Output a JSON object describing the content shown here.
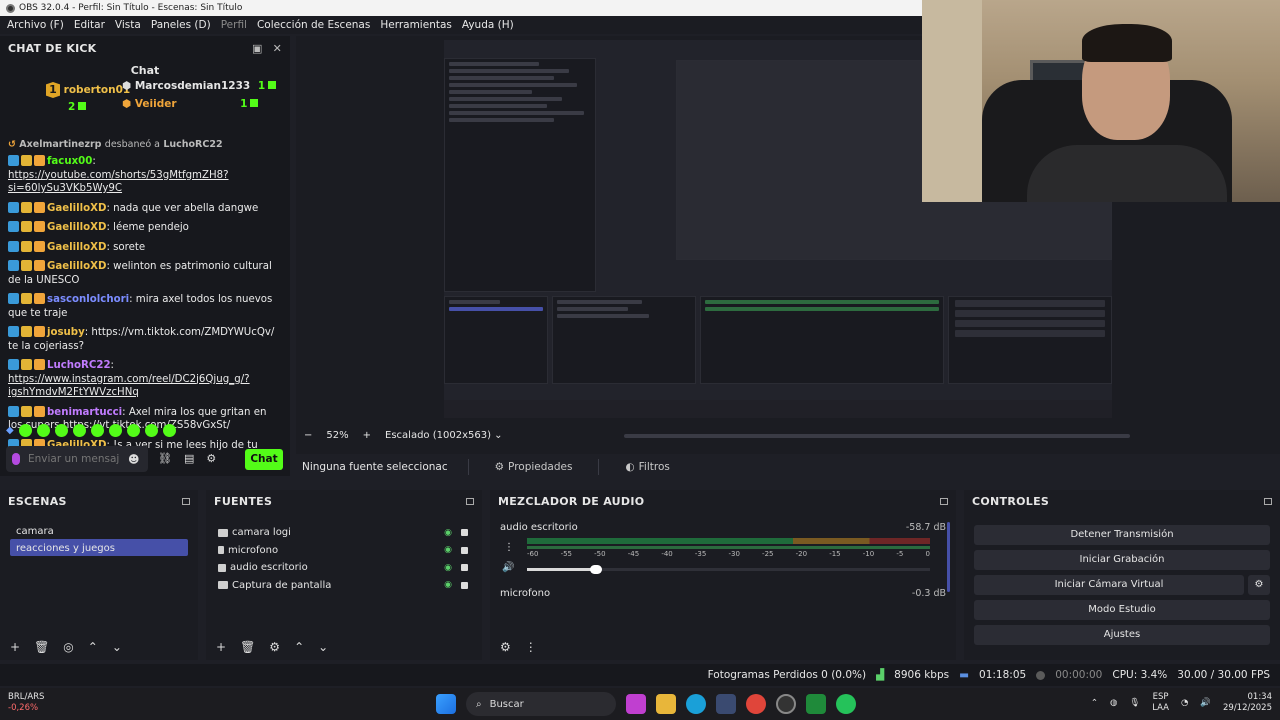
{
  "window": {
    "title": "OBS 32.0.4 - Perfil: Sin Título - Escenas: Sin Título"
  },
  "menu": [
    "Archivo (F)",
    "Editar",
    "Vista",
    "Paneles (D)",
    "Perfil",
    "Colección de Escenas",
    "Herramientas",
    "Ayuda (H)"
  ],
  "chat": {
    "dock_title": "CHAT DE KICK",
    "sub_title": "Chat",
    "leaders": [
      {
        "rank": "1",
        "name": "roberton01",
        "count": "2"
      },
      {
        "name": "Marcosdemian1233",
        "count": "1"
      },
      {
        "name": "Veiider",
        "count": "1"
      }
    ],
    "announcement": {
      "user": "Axelmartinezrp",
      "action": "desbaneó a",
      "target": "LuchoRC22"
    },
    "messages": [
      {
        "user": "facux00",
        "text": "https://youtube.com/shorts/53gMtfgmZH8?si=60lySu3VKb5Wy9C",
        "link": true,
        "color": "#53fc18"
      },
      {
        "user": "GaelilloXD",
        "text": "nada que ver abella dangwe",
        "color": "#f0c049"
      },
      {
        "user": "GaelilloXD",
        "text": "léeme pendejo",
        "color": "#f0c049"
      },
      {
        "user": "GaelilloXD",
        "text": "sorete",
        "color": "#f0c049"
      },
      {
        "user": "GaelilloXD",
        "text": "welinton es patrimonio cultural de la UNESCO",
        "color": "#f0c049"
      },
      {
        "user": "sasconlolchori",
        "text": "mira axel todos los nuevos que te traje",
        "color": "#7b8cff"
      },
      {
        "user": "josuby",
        "text": "https://vm.tiktok.com/ZMDYWUcQv/ te la cojeriass?",
        "color": "#f0c049"
      },
      {
        "user": "LuchoRC22",
        "text": "https://www.instagram.com/reel/DC2j6Qjug_g/?igshYmdvM2FtYWVzcHNq",
        "link": true,
        "color": "#c17cff"
      },
      {
        "user": "benimartucci",
        "text": "Axel mira los que gritan en los supers https://vt.tiktok.com/ZS58vGxSt/",
        "color": "#c17cff"
      },
      {
        "user": "GaelilloXD",
        "text": "!s a ver si me lees hijo de tu puta madre",
        "color": "#f0c049"
      }
    ],
    "input_placeholder": "Enviar un mensaje",
    "send_label": "Chat"
  },
  "preview": {
    "zoom": "52%",
    "scale_label": "Escalado (1002x563)",
    "no_source": "Ninguna fuente seleccionac",
    "properties": "Propiedades",
    "filters": "Filtros"
  },
  "scenes": {
    "title": "ESCENAS",
    "items": [
      "camara",
      "reacciones y juegos"
    ],
    "selected": "reacciones y juegos"
  },
  "sources": {
    "title": "FUENTES",
    "items": [
      "camara logi",
      "microfono",
      "audio escritorio",
      "Captura de pantalla"
    ]
  },
  "mixer": {
    "title": "MEZCLADOR DE AUDIO",
    "tracks": [
      {
        "name": "audio escritorio",
        "db": "-58.7 dB",
        "volume": 0.17
      },
      {
        "name": "microfono",
        "db": "-0.3 dB"
      }
    ],
    "scale": [
      "-60",
      "-55",
      "-50",
      "-45",
      "-40",
      "-35",
      "-30",
      "-25",
      "-20",
      "-15",
      "-10",
      "-5",
      "0"
    ]
  },
  "controls": {
    "title": "CONTROLES",
    "buttons": [
      "Detener Transmisión",
      "Iniciar Grabación",
      "Iniciar Cámara Virtual",
      "Modo Estudio",
      "Ajustes"
    ]
  },
  "status": {
    "dropped": "Fotogramas Perdidos 0 (0.0%)",
    "bitrate": "8906 kbps",
    "stream_time": "01:18:05",
    "rec_time": "00:00:00",
    "cpu": "CPU: 3.4%",
    "fps": "30.00 / 30.00 FPS"
  },
  "taskbar": {
    "ticker": "BRL/ARS",
    "ticker_change": "-0,26%",
    "search": "Buscar",
    "lang": "ESP",
    "lang_sub": "LAA",
    "time": "01:34",
    "date": "29/12/2025"
  },
  "colors": {
    "accent": "#53fc18",
    "selection": "#4650a8",
    "panel": "#1b1c22"
  }
}
